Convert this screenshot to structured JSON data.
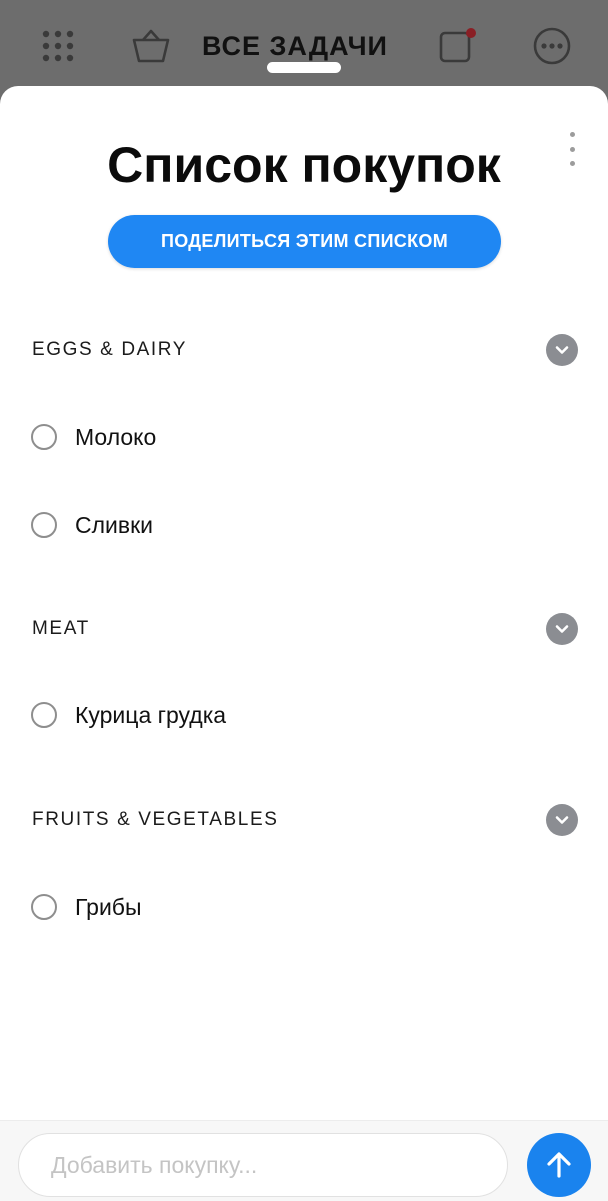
{
  "header": {
    "title": "ВСЕ ЗАДАЧИ",
    "icons": [
      "grid-icon",
      "basket-icon",
      "square-notification-icon",
      "more-icon"
    ],
    "notification_dot_color": "#8a1f25"
  },
  "list": {
    "title": "Список покупок",
    "share_label": "ПОДЕЛИТЬСЯ ЭТИМ СПИСКОМ",
    "accent_color": "#1f87f3",
    "sections": [
      {
        "label": "EGGS & DAIRY",
        "items": [
          {
            "label": "Молоко"
          },
          {
            "label": "Сливки"
          }
        ]
      },
      {
        "label": "MEAT",
        "items": [
          {
            "label": "Курица грудка"
          }
        ]
      },
      {
        "label": "FRUITS & VEGETABLES",
        "items": [
          {
            "label": "Грибы"
          }
        ]
      }
    ]
  },
  "composer": {
    "placeholder": "Добавить покупку...",
    "send_icon": "arrow-up-icon"
  }
}
